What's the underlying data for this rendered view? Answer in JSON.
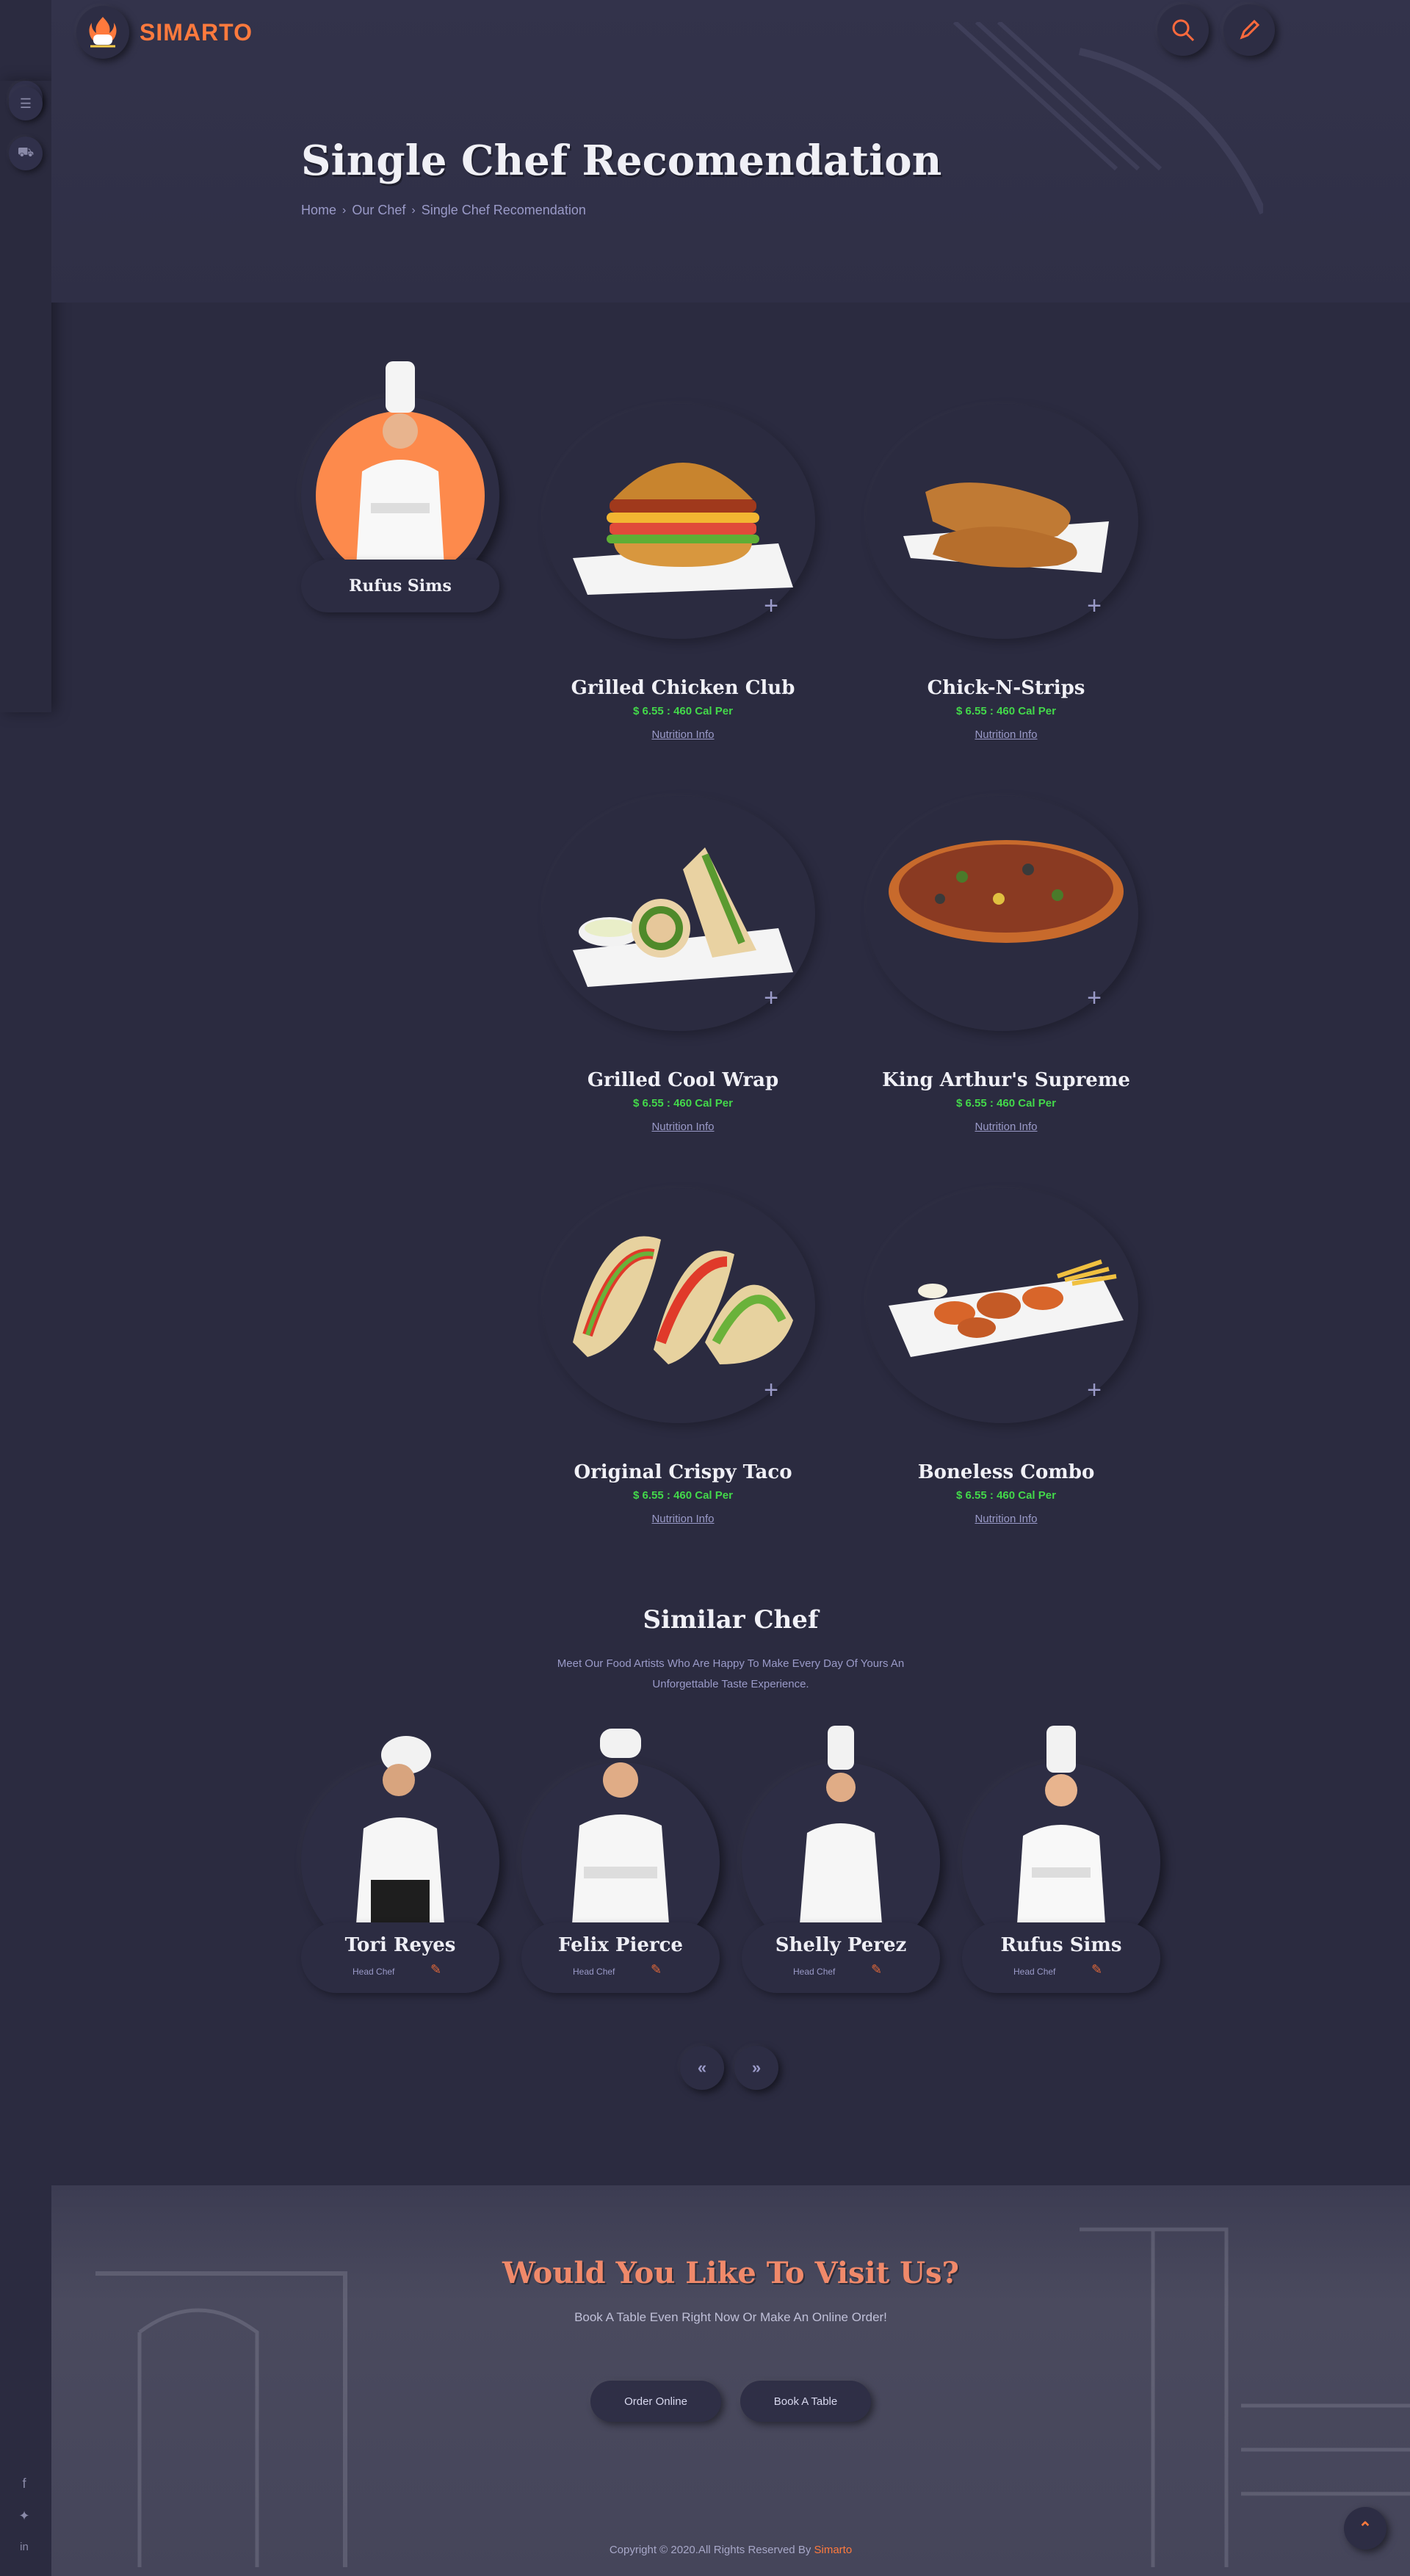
{
  "brand": {
    "name": "SIMARTO",
    "accent": "#ff7a3d"
  },
  "header": {
    "title": "Single Chef Recomendation",
    "breadcrumb": [
      "Home",
      "Our Chef",
      "Single Chef Recomendation"
    ]
  },
  "chef": {
    "name": "Rufus Sims"
  },
  "dishes": [
    {
      "name": "Grilled Chicken Club",
      "price": "$ 6.55 : 460 Cal Per",
      "link": "Nutrition Info"
    },
    {
      "name": "Chick-N-Strips",
      "price": "$ 6.55 : 460 Cal Per",
      "link": "Nutrition Info"
    },
    {
      "name": "Grilled Cool Wrap",
      "price": "$ 6.55 : 460 Cal Per",
      "link": "Nutrition Info"
    },
    {
      "name": "King Arthur's Supreme",
      "price": "$ 6.55 : 460 Cal Per",
      "link": "Nutrition Info"
    },
    {
      "name": "Original Crispy Taco",
      "price": "$ 6.55 : 460 Cal Per",
      "link": "Nutrition Info"
    },
    {
      "name": "Boneless Combo",
      "price": "$ 6.55 : 460 Cal Per",
      "link": "Nutrition Info"
    }
  ],
  "similar": {
    "title": "Similar Chef",
    "subtitle": "Meet Our Food Artists Who Are Happy To Make Every Day Of Yours An Unforgettable Taste Experience.",
    "chefs": [
      {
        "name": "Tori Reyes",
        "role": "Head Chef"
      },
      {
        "name": "Felix Pierce",
        "role": "Head Chef"
      },
      {
        "name": "Shelly Perez",
        "role": "Head Chef"
      },
      {
        "name": "Rufus Sims",
        "role": "Head Chef"
      }
    ],
    "prev": "«",
    "next": "»"
  },
  "visit": {
    "title": "Would You Like To Visit Us?",
    "subtitle": "Book A Table Even Right Now Or Make An Online Order!",
    "order_label": "Order Online",
    "book_label": "Book A Table"
  },
  "footer": {
    "copyright": "Copyright © 2020.All Rights Reserved By",
    "brand": "Simarto"
  }
}
